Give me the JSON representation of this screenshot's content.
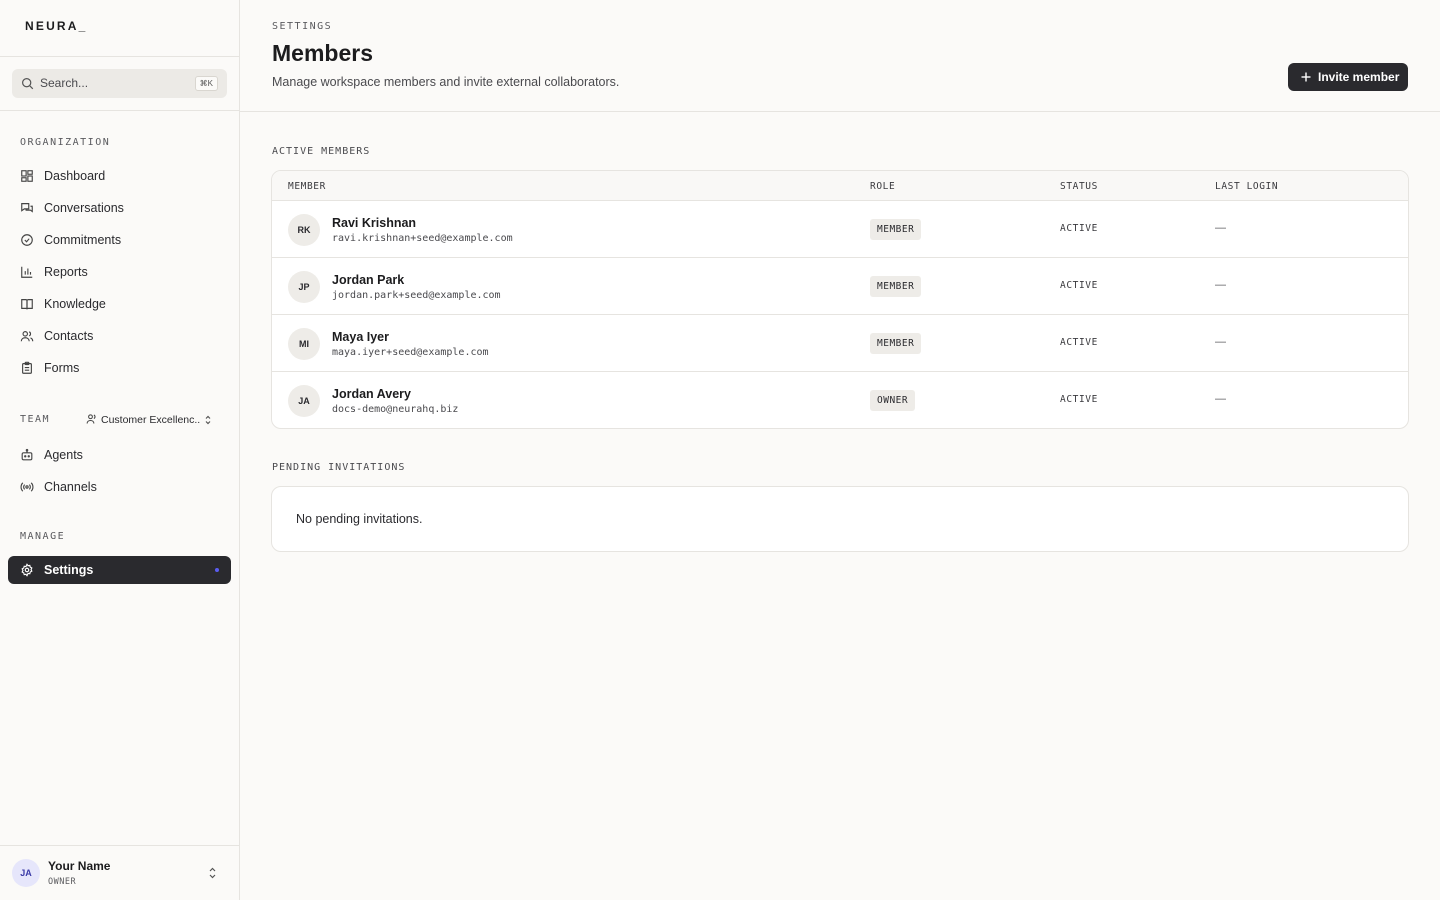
{
  "app": {
    "logo": "NEURA_"
  },
  "search": {
    "placeholder": "Search...",
    "shortcut": "⌘K"
  },
  "sidebar": {
    "organization_label": "ORGANIZATION",
    "org_items": [
      {
        "label": "Dashboard",
        "icon": "dashboard-icon"
      },
      {
        "label": "Conversations",
        "icon": "chat-icon"
      },
      {
        "label": "Commitments",
        "icon": "check-circle-icon"
      },
      {
        "label": "Reports",
        "icon": "bar-chart-icon"
      },
      {
        "label": "Knowledge",
        "icon": "book-icon"
      },
      {
        "label": "Contacts",
        "icon": "users-icon"
      },
      {
        "label": "Forms",
        "icon": "clipboard-icon"
      }
    ],
    "team_label": "TEAM",
    "team_select": "Customer Excellenc...",
    "team_items": [
      {
        "label": "Agents",
        "icon": "bot-icon"
      },
      {
        "label": "Channels",
        "icon": "broadcast-icon"
      }
    ],
    "manage_label": "MANAGE",
    "manage_items": [
      {
        "label": "Settings",
        "icon": "gear-icon",
        "active": true
      }
    ]
  },
  "user": {
    "initials": "JA",
    "name": "Your Name",
    "role": "OWNER"
  },
  "header": {
    "breadcrumb": "SETTINGS",
    "title": "Members",
    "description": "Manage workspace members and invite external collaborators.",
    "invite_label": "Invite member"
  },
  "active_members": {
    "label": "ACTIVE MEMBERS",
    "columns": [
      "MEMBER",
      "ROLE",
      "STATUS",
      "LAST LOGIN"
    ],
    "rows": [
      {
        "initials": "RK",
        "name": "Ravi Krishnan",
        "email": "ravi.krishnan+seed@example.com",
        "role": "MEMBER",
        "status": "ACTIVE",
        "last_login": "—"
      },
      {
        "initials": "JP",
        "name": "Jordan Park",
        "email": "jordan.park+seed@example.com",
        "role": "MEMBER",
        "status": "ACTIVE",
        "last_login": "—"
      },
      {
        "initials": "MI",
        "name": "Maya Iyer",
        "email": "maya.iyer+seed@example.com",
        "role": "MEMBER",
        "status": "ACTIVE",
        "last_login": "—"
      },
      {
        "initials": "JA",
        "name": "Jordan Avery",
        "email": "docs-demo@neurahq.biz",
        "role": "OWNER",
        "status": "ACTIVE",
        "last_login": "—"
      }
    ]
  },
  "pending": {
    "label": "PENDING INVITATIONS",
    "empty_text": "No pending invitations."
  },
  "colors": {
    "active_nav": "#2a2a2e",
    "accent_dot": "#5a5cf0",
    "avatar_user_bg": "#e6e6fb"
  }
}
